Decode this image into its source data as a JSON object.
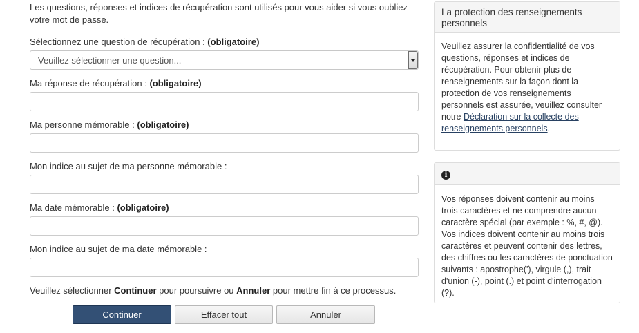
{
  "intro_text": "Les questions, réponses et indices de récupération sont utilisés pour vous aider si vous oubliez votre mot de passe.",
  "required_tag": "(obligatoire)",
  "fields": {
    "question": {
      "label": "Sélectionnez une question de récupération : ",
      "selected": "Veuillez sélectionner une question..."
    },
    "answer": {
      "label": "Ma réponse de récupération : ",
      "value": ""
    },
    "person": {
      "label": "Ma personne mémorable : ",
      "value": ""
    },
    "person_hint": {
      "label": "Mon indice au sujet de ma personne mémorable :",
      "value": ""
    },
    "date": {
      "label": "Ma date mémorable : ",
      "value": ""
    },
    "date_hint": {
      "label": "Mon indice au sujet de ma date mémorable :",
      "value": ""
    }
  },
  "instruction": {
    "prefix": "Veuillez sélectionner ",
    "continue_word": "Continuer",
    "middle": " pour poursuivre ou ",
    "cancel_word": "Annuler",
    "suffix": " pour mettre fin à ce processus."
  },
  "buttons": {
    "continue": "Continuer",
    "clear": "Effacer tout",
    "cancel": "Annuler"
  },
  "privacy_panel": {
    "title": "La protection des renseignements personnels",
    "body": "Veuillez assurer la confidentialité de vos questions, réponses et indices de récupération. Pour obtenir plus de renseignements sur la façon dont la protection de vos renseignements personnels est assurée, veuillez consulter notre ",
    "link": "Déclaration sur la collecte des renseignements personnels",
    "body_end": "."
  },
  "info_panel": {
    "icon": "info-icon",
    "body": "Vos réponses doivent contenir au moins trois caractères et ne comprendre aucun caractère spécial (par exemple : %, #, @). Vos indices doivent contenir au moins trois caractères et peuvent contenir des lettres, des chiffres ou les caractères de ponctuation suivants : apostrophe('), virgule (,), trait d'union (-), point (.) et point d'interrogation (?)."
  },
  "colors": {
    "primary_button": "#335075",
    "link": "#284162",
    "panel_heading_bg": "#f5f5f5"
  }
}
